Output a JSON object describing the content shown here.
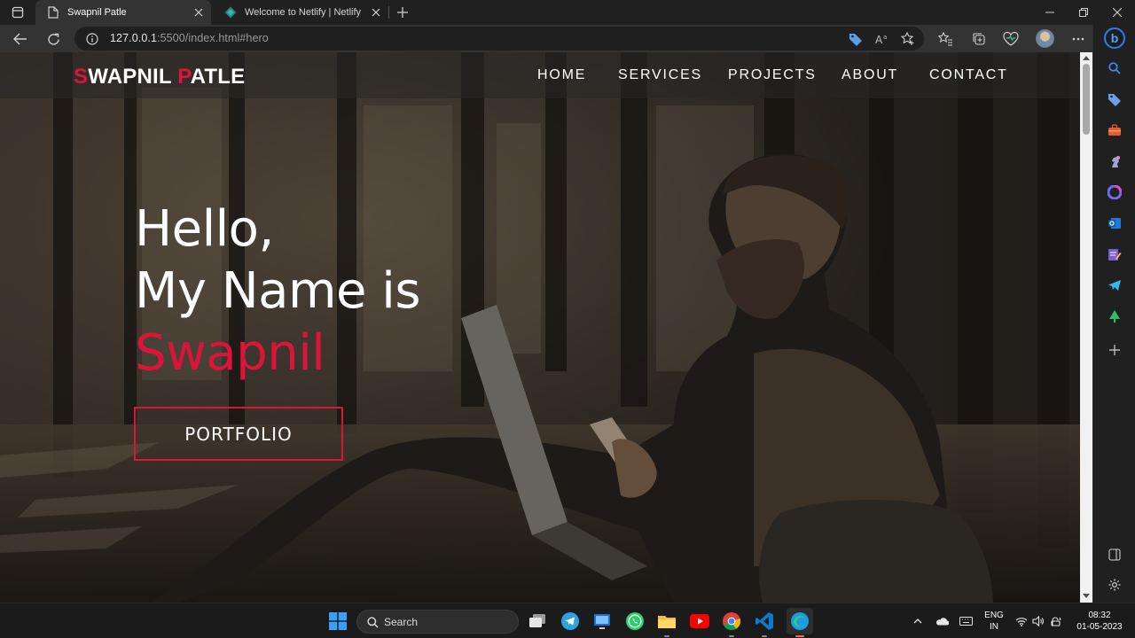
{
  "browser": {
    "tabs": [
      {
        "title": "Swapnil Patle",
        "active": true
      },
      {
        "title": "Welcome to Netlify | Netlify",
        "active": false
      }
    ],
    "url_host": "127.0.0.1",
    "url_rest": ":5500/index.html#hero"
  },
  "site": {
    "brand_s": "S",
    "brand_wapnil": "WAPNIL ",
    "brand_p": "P",
    "brand_atle": "ATLE",
    "nav": [
      "HOME",
      "SERVICES",
      "PROJECTS",
      "ABOUT",
      "CONTACT"
    ],
    "hero": {
      "line1": "Hello,",
      "line2": "My Name is",
      "name": "Swapnil"
    },
    "cta": "PORTFOLIO",
    "accent_color": "#dc143c"
  },
  "taskbar": {
    "search_label": "Search",
    "lang_line1": "ENG",
    "lang_line2": "IN",
    "time": "08:32",
    "date": "01-05-2023",
    "apps": [
      "windows-start-icon",
      "task-view-icon",
      "telegram-icon",
      "remote-desktop-icon",
      "whatsapp-icon",
      "file-explorer-icon",
      "youtube-icon",
      "chrome-icon",
      "vscode-icon",
      "edge-icon"
    ]
  }
}
